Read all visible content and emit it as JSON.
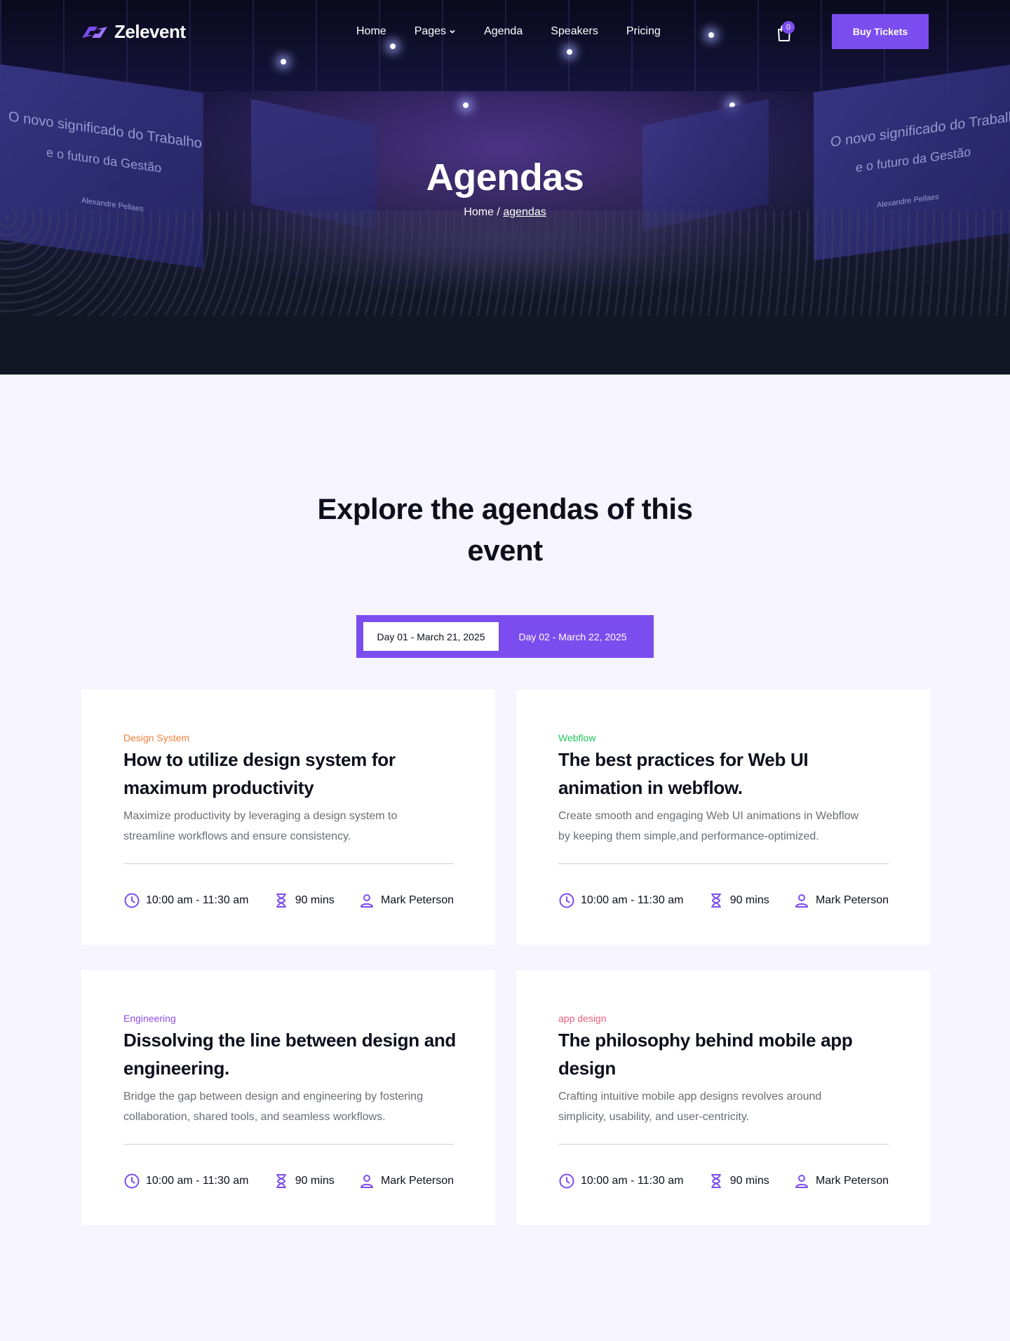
{
  "brand": {
    "name": "Zelevent",
    "accent": "#7c4dee"
  },
  "nav": {
    "items": [
      {
        "label": "Home",
        "dropdown": false
      },
      {
        "label": "Pages",
        "dropdown": true
      },
      {
        "label": "Agenda",
        "dropdown": false
      },
      {
        "label": "Speakers",
        "dropdown": false
      },
      {
        "label": "Pricing",
        "dropdown": false
      }
    ],
    "cart_count": "0",
    "cta_label": "Buy Tickets"
  },
  "hero": {
    "title": "Agendas",
    "breadcrumb_home": "Home",
    "breadcrumb_sep": "/",
    "breadcrumb_current": "agendas",
    "screen_text": {
      "left_line1": "O novo significado do Trabalho",
      "left_line2": "e o futuro da Gestão",
      "left_name": "Alexandre Pellaes",
      "right_line1": "O novo significado do Trabalho",
      "right_line2": "e o futuro da Gestão",
      "right_name": "Alexandre Pellaes"
    }
  },
  "section": {
    "title_line1": "Explore the agendas of this",
    "title_line2": "event"
  },
  "tabs": [
    {
      "label": "Day 01 - March 21, 2025",
      "active": true
    },
    {
      "label": "Day 02 - March 22, 2025",
      "active": false
    }
  ],
  "cards": [
    {
      "category": "Design System",
      "category_color": "#f47f3c",
      "title": "How to utilize design system for maximum productivity",
      "description": "Maximize productivity by leveraging a design system to streamline workflows and ensure consistency.",
      "time": "10:00 am - 11:30 am",
      "duration": "90 mins",
      "speaker": "Mark Peterson"
    },
    {
      "category": "Webflow",
      "category_color": "#22c55e",
      "title": "The best practices for Web UI animation in webflow.",
      "description": "Create smooth and engaging Web UI animations in Webflow by keeping them simple,and performance-optimized.",
      "time": "10:00 am - 11:30 am",
      "duration": "90 mins",
      "speaker": "Mark Peterson"
    },
    {
      "category": "Engineering",
      "category_color": "#8b4de8",
      "title": "Dissolving the line between design and engineering.",
      "description": "Bridge the gap between design and engineering by fostering collaboration, shared tools, and seamless workflows.",
      "time": "10:00 am - 11:30 am",
      "duration": "90 mins",
      "speaker": "Mark Peterson"
    },
    {
      "category": "app design",
      "category_color": "#f2607c",
      "title": "The philosophy behind mobile app design",
      "description": "Crafting intuitive mobile app designs revolves around simplicity, usability, and user-centricity.",
      "time": "10:00 am - 11:30 am",
      "duration": "90 mins",
      "speaker": "Mark Peterson"
    }
  ]
}
